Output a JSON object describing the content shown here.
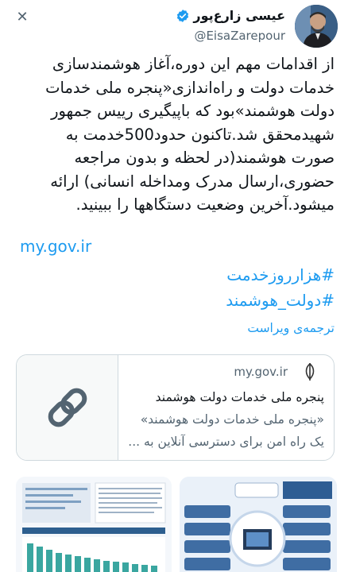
{
  "header": {
    "display_name": "عیسی زارع‌پور",
    "handle": "@EisaZarepour",
    "close_glyph": "✕"
  },
  "tweet": {
    "lines": [
      "از اقدامات مهم این دوره،آغاز هوشمندسازی",
      "خدمات دولت و راه‌اندازی«پنجره ملی خدمات",
      "دولت هوشمند»بود که باپیگیری رییس جمهور",
      "شهیدمحقق شد.تاکنون حدود500خدمت به",
      "صورت هوشمند(در لحظه و بدون مراجعه",
      "حضوری،ارسال مدرک ومداخله انسانی) ارائه",
      "میشود.آخرین وضعیت دستگاهها را ببینید."
    ],
    "url": "my.gov.ir",
    "hashtags": [
      "#هزارروزخدمت",
      "#دولت_هوشمند"
    ],
    "translate_label": "ترجمه‌ی ویراست"
  },
  "card": {
    "domain": "my.gov.ir",
    "title": "پنجره ملی خدمات دولت هوشمند",
    "description_lines": [
      "«پنجره ملی خدمات دولت هوشمند»",
      "یک راه امن برای دسترسی آنلاین به ..."
    ]
  },
  "colors": {
    "link": "#1d9bf0",
    "muted": "#536471",
    "border": "#cfd9de"
  }
}
